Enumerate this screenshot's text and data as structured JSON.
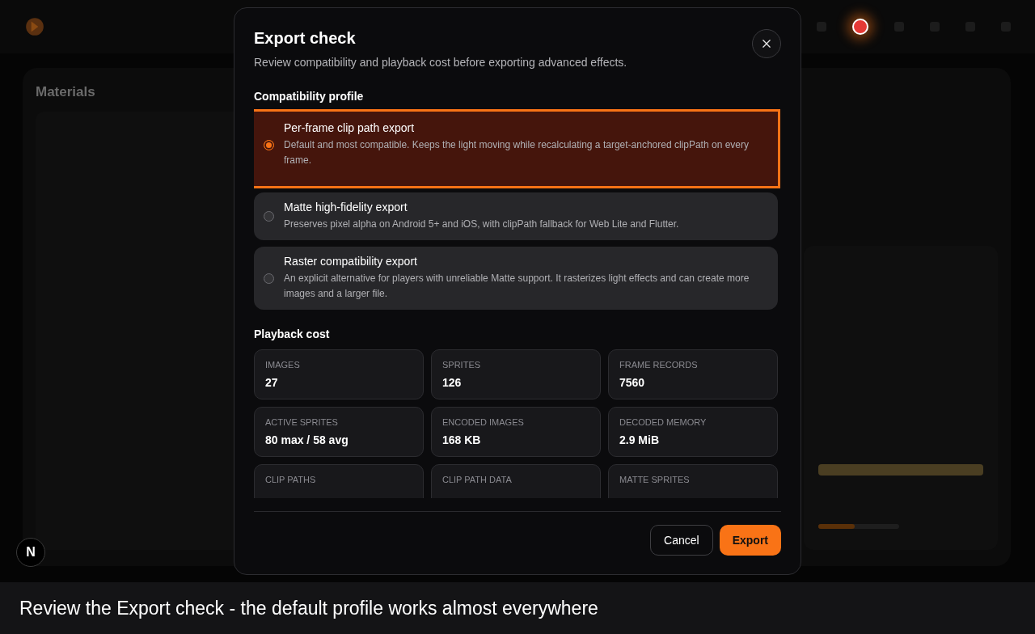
{
  "background": {
    "panel_title": "Materials",
    "slider": {
      "level": 0.45
    }
  },
  "dialog": {
    "title": "Export check",
    "subtitle": "Review compatibility and playback cost before exporting advanced effects.",
    "profile_heading": "Compatibility profile",
    "options": [
      {
        "title": "Per-frame clip path export",
        "description": "Default and most compatible. Keeps the light moving while recalculating a target-anchored clipPath on every frame.",
        "selected": true
      },
      {
        "title": "Matte high-fidelity export",
        "description": "Preserves pixel alpha on Android 5+ and iOS, with clipPath fallback for Web Lite and Flutter.",
        "selected": false
      },
      {
        "title": "Raster compatibility export",
        "description": "An explicit alternative for players with unreliable Matte support. It rasterizes light effects and can create more images and a larger file.",
        "selected": false
      }
    ],
    "cost_heading": "Playback cost",
    "stats": [
      {
        "label": "IMAGES",
        "value": "27"
      },
      {
        "label": "SPRITES",
        "value": "126"
      },
      {
        "label": "FRAME RECORDS",
        "value": "7560"
      },
      {
        "label": "ACTIVE SPRITES",
        "value": "80 max / 58 avg"
      },
      {
        "label": "ENCODED IMAGES",
        "value": "168 KB"
      },
      {
        "label": "DECODED MEMORY",
        "value": "2.9 MiB"
      },
      {
        "label": "CLIP PATHS"
      },
      {
        "label": "CLIP PATH DATA"
      },
      {
        "label": "MATTE SPRITES"
      }
    ],
    "buttons": [
      {
        "label": "Cancel",
        "kind": "secondary"
      },
      {
        "label": "Export",
        "kind": "primary"
      }
    ]
  },
  "badge": "N",
  "caption": "Review the Export check - the default profile works almost everywhere"
}
